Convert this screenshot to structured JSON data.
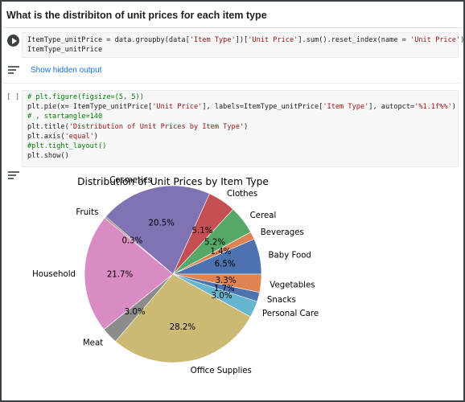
{
  "heading": "What is the distribiton of unit prices for each item type",
  "cell1": {
    "code_lines": [
      [
        {
          "t": "ItemType_unitPrice = data.groupby(data["
        },
        {
          "t": "'Item Type'",
          "c": "str"
        },
        {
          "t": "])["
        },
        {
          "t": "'Unit Price'",
          "c": "str"
        },
        {
          "t": "].sum().reset_index(name = "
        },
        {
          "t": "'Unit Price'",
          "c": "str"
        },
        {
          "t": ")"
        }
      ],
      [
        {
          "t": "ItemType_unitPrice"
        }
      ]
    ]
  },
  "hidden_output_label": "Show hidden output",
  "cell2": {
    "bracket": "[ ]",
    "code_lines": [
      [
        {
          "t": "# plt.figure(figsize=(5, 5))",
          "c": "com"
        }
      ],
      [
        {
          "t": "plt.pie(x= ItemType_unitPrice["
        },
        {
          "t": "'Unit Price'",
          "c": "str"
        },
        {
          "t": "], labels=ItemType_unitPrice["
        },
        {
          "t": "'Item Type'",
          "c": "str"
        },
        {
          "t": "], autopct="
        },
        {
          "t": "'%1.1f%%'",
          "c": "str"
        },
        {
          "t": ")"
        }
      ],
      [
        {
          "t": "# , startangle=140",
          "c": "com"
        }
      ],
      [
        {
          "t": "plt.title("
        },
        {
          "t": "'Distribution of Unit Prices by Item Type'",
          "c": "str"
        },
        {
          "t": ")"
        }
      ],
      [
        {
          "t": "plt.axis("
        },
        {
          "t": "'equal'",
          "c": "str"
        },
        {
          "t": ")"
        }
      ],
      [
        {
          "t": "#plt.tight_layout()",
          "c": "com"
        }
      ],
      [
        {
          "t": "plt.show()"
        }
      ]
    ]
  },
  "chart_data": {
    "type": "pie",
    "title": "Distribution of Unit Prices by Item Type",
    "slices": [
      {
        "label": "Baby Food",
        "pct": 6.5,
        "pct_text": "6.5%",
        "color": "#4c72b0"
      },
      {
        "label": "Beverages",
        "pct": 1.4,
        "pct_text": "1.4%",
        "color": "#dd8452"
      },
      {
        "label": "Cereal",
        "pct": 5.2,
        "pct_text": "5.2%",
        "color": "#55a868"
      },
      {
        "label": "Clothes",
        "pct": 5.1,
        "pct_text": "5.1%",
        "color": "#c44e52"
      },
      {
        "label": "Cosmetics",
        "pct": 20.5,
        "pct_text": "20.5%",
        "color": "#8172b3"
      },
      {
        "label": "Fruits",
        "pct": 0.3,
        "pct_text": "0.3%",
        "color": "#937860"
      },
      {
        "label": "Household",
        "pct": 21.7,
        "pct_text": "21.7%",
        "color": "#da8bc3"
      },
      {
        "label": "Meat",
        "pct": 3.0,
        "pct_text": "3.0%",
        "color": "#8c8c8c"
      },
      {
        "label": "Office Supplies",
        "pct": 28.2,
        "pct_text": "28.2%",
        "color": "#ccb974"
      },
      {
        "label": "Personal Care",
        "pct": 3.0,
        "pct_text": "3.0%",
        "color": "#64b5cd"
      },
      {
        "label": "Snacks",
        "pct": 1.7,
        "pct_text": "1.7%",
        "color": "#4c72b0"
      },
      {
        "label": "Vegetables",
        "pct": 3.3,
        "pct_text": "3.3%",
        "color": "#dd8452"
      }
    ]
  }
}
